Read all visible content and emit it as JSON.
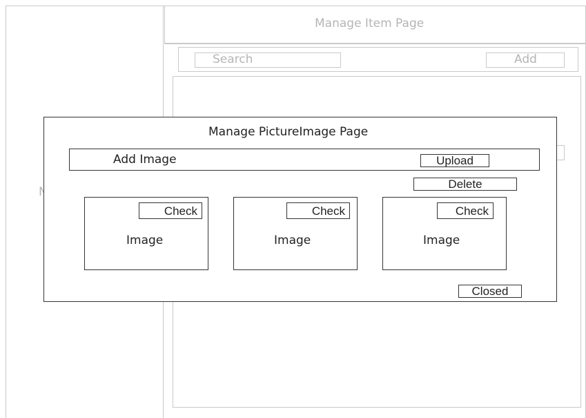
{
  "background_page": {
    "header_title": "Manage Item Page",
    "search_placeholder": "Search",
    "add_label": "Add",
    "sidebar_partial_text": "N"
  },
  "modal": {
    "title": "Manage PictureImage Page",
    "add_image_label": "Add Image",
    "upload_label": "Upload",
    "delete_label": "Delete",
    "cards": [
      {
        "check_label": "Check",
        "image_label": "Image"
      },
      {
        "check_label": "Check",
        "image_label": "Image"
      },
      {
        "check_label": "Check",
        "image_label": "Image"
      }
    ],
    "closed_label": "Closed"
  }
}
